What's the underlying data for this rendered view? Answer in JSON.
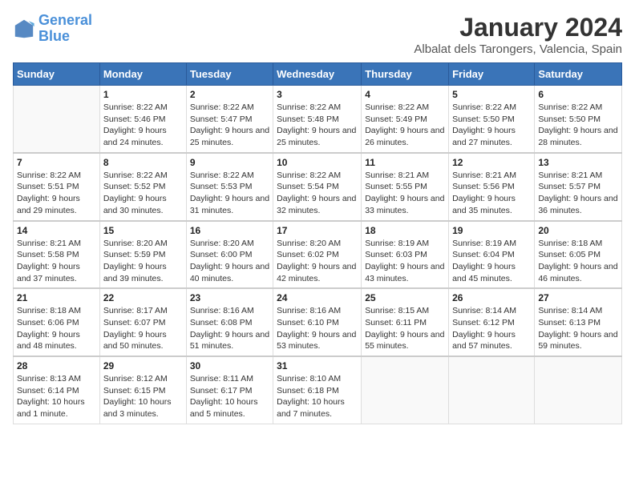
{
  "logo": {
    "line1": "General",
    "line2": "Blue"
  },
  "header": {
    "month": "January 2024",
    "location": "Albalat dels Tarongers, Valencia, Spain"
  },
  "weekdays": [
    "Sunday",
    "Monday",
    "Tuesday",
    "Wednesday",
    "Thursday",
    "Friday",
    "Saturday"
  ],
  "weeks": [
    [
      {
        "day": "",
        "sunrise": "",
        "sunset": "",
        "daylight": ""
      },
      {
        "day": "1",
        "sunrise": "Sunrise: 8:22 AM",
        "sunset": "Sunset: 5:46 PM",
        "daylight": "Daylight: 9 hours and 24 minutes."
      },
      {
        "day": "2",
        "sunrise": "Sunrise: 8:22 AM",
        "sunset": "Sunset: 5:47 PM",
        "daylight": "Daylight: 9 hours and 25 minutes."
      },
      {
        "day": "3",
        "sunrise": "Sunrise: 8:22 AM",
        "sunset": "Sunset: 5:48 PM",
        "daylight": "Daylight: 9 hours and 25 minutes."
      },
      {
        "day": "4",
        "sunrise": "Sunrise: 8:22 AM",
        "sunset": "Sunset: 5:49 PM",
        "daylight": "Daylight: 9 hours and 26 minutes."
      },
      {
        "day": "5",
        "sunrise": "Sunrise: 8:22 AM",
        "sunset": "Sunset: 5:50 PM",
        "daylight": "Daylight: 9 hours and 27 minutes."
      },
      {
        "day": "6",
        "sunrise": "Sunrise: 8:22 AM",
        "sunset": "Sunset: 5:50 PM",
        "daylight": "Daylight: 9 hours and 28 minutes."
      }
    ],
    [
      {
        "day": "7",
        "sunrise": "Sunrise: 8:22 AM",
        "sunset": "Sunset: 5:51 PM",
        "daylight": "Daylight: 9 hours and 29 minutes."
      },
      {
        "day": "8",
        "sunrise": "Sunrise: 8:22 AM",
        "sunset": "Sunset: 5:52 PM",
        "daylight": "Daylight: 9 hours and 30 minutes."
      },
      {
        "day": "9",
        "sunrise": "Sunrise: 8:22 AM",
        "sunset": "Sunset: 5:53 PM",
        "daylight": "Daylight: 9 hours and 31 minutes."
      },
      {
        "day": "10",
        "sunrise": "Sunrise: 8:22 AM",
        "sunset": "Sunset: 5:54 PM",
        "daylight": "Daylight: 9 hours and 32 minutes."
      },
      {
        "day": "11",
        "sunrise": "Sunrise: 8:21 AM",
        "sunset": "Sunset: 5:55 PM",
        "daylight": "Daylight: 9 hours and 33 minutes."
      },
      {
        "day": "12",
        "sunrise": "Sunrise: 8:21 AM",
        "sunset": "Sunset: 5:56 PM",
        "daylight": "Daylight: 9 hours and 35 minutes."
      },
      {
        "day": "13",
        "sunrise": "Sunrise: 8:21 AM",
        "sunset": "Sunset: 5:57 PM",
        "daylight": "Daylight: 9 hours and 36 minutes."
      }
    ],
    [
      {
        "day": "14",
        "sunrise": "Sunrise: 8:21 AM",
        "sunset": "Sunset: 5:58 PM",
        "daylight": "Daylight: 9 hours and 37 minutes."
      },
      {
        "day": "15",
        "sunrise": "Sunrise: 8:20 AM",
        "sunset": "Sunset: 5:59 PM",
        "daylight": "Daylight: 9 hours and 39 minutes."
      },
      {
        "day": "16",
        "sunrise": "Sunrise: 8:20 AM",
        "sunset": "Sunset: 6:00 PM",
        "daylight": "Daylight: 9 hours and 40 minutes."
      },
      {
        "day": "17",
        "sunrise": "Sunrise: 8:20 AM",
        "sunset": "Sunset: 6:02 PM",
        "daylight": "Daylight: 9 hours and 42 minutes."
      },
      {
        "day": "18",
        "sunrise": "Sunrise: 8:19 AM",
        "sunset": "Sunset: 6:03 PM",
        "daylight": "Daylight: 9 hours and 43 minutes."
      },
      {
        "day": "19",
        "sunrise": "Sunrise: 8:19 AM",
        "sunset": "Sunset: 6:04 PM",
        "daylight": "Daylight: 9 hours and 45 minutes."
      },
      {
        "day": "20",
        "sunrise": "Sunrise: 8:18 AM",
        "sunset": "Sunset: 6:05 PM",
        "daylight": "Daylight: 9 hours and 46 minutes."
      }
    ],
    [
      {
        "day": "21",
        "sunrise": "Sunrise: 8:18 AM",
        "sunset": "Sunset: 6:06 PM",
        "daylight": "Daylight: 9 hours and 48 minutes."
      },
      {
        "day": "22",
        "sunrise": "Sunrise: 8:17 AM",
        "sunset": "Sunset: 6:07 PM",
        "daylight": "Daylight: 9 hours and 50 minutes."
      },
      {
        "day": "23",
        "sunrise": "Sunrise: 8:16 AM",
        "sunset": "Sunset: 6:08 PM",
        "daylight": "Daylight: 9 hours and 51 minutes."
      },
      {
        "day": "24",
        "sunrise": "Sunrise: 8:16 AM",
        "sunset": "Sunset: 6:10 PM",
        "daylight": "Daylight: 9 hours and 53 minutes."
      },
      {
        "day": "25",
        "sunrise": "Sunrise: 8:15 AM",
        "sunset": "Sunset: 6:11 PM",
        "daylight": "Daylight: 9 hours and 55 minutes."
      },
      {
        "day": "26",
        "sunrise": "Sunrise: 8:14 AM",
        "sunset": "Sunset: 6:12 PM",
        "daylight": "Daylight: 9 hours and 57 minutes."
      },
      {
        "day": "27",
        "sunrise": "Sunrise: 8:14 AM",
        "sunset": "Sunset: 6:13 PM",
        "daylight": "Daylight: 9 hours and 59 minutes."
      }
    ],
    [
      {
        "day": "28",
        "sunrise": "Sunrise: 8:13 AM",
        "sunset": "Sunset: 6:14 PM",
        "daylight": "Daylight: 10 hours and 1 minute."
      },
      {
        "day": "29",
        "sunrise": "Sunrise: 8:12 AM",
        "sunset": "Sunset: 6:15 PM",
        "daylight": "Daylight: 10 hours and 3 minutes."
      },
      {
        "day": "30",
        "sunrise": "Sunrise: 8:11 AM",
        "sunset": "Sunset: 6:17 PM",
        "daylight": "Daylight: 10 hours and 5 minutes."
      },
      {
        "day": "31",
        "sunrise": "Sunrise: 8:10 AM",
        "sunset": "Sunset: 6:18 PM",
        "daylight": "Daylight: 10 hours and 7 minutes."
      },
      {
        "day": "",
        "sunrise": "",
        "sunset": "",
        "daylight": ""
      },
      {
        "day": "",
        "sunrise": "",
        "sunset": "",
        "daylight": ""
      },
      {
        "day": "",
        "sunrise": "",
        "sunset": "",
        "daylight": ""
      }
    ]
  ]
}
